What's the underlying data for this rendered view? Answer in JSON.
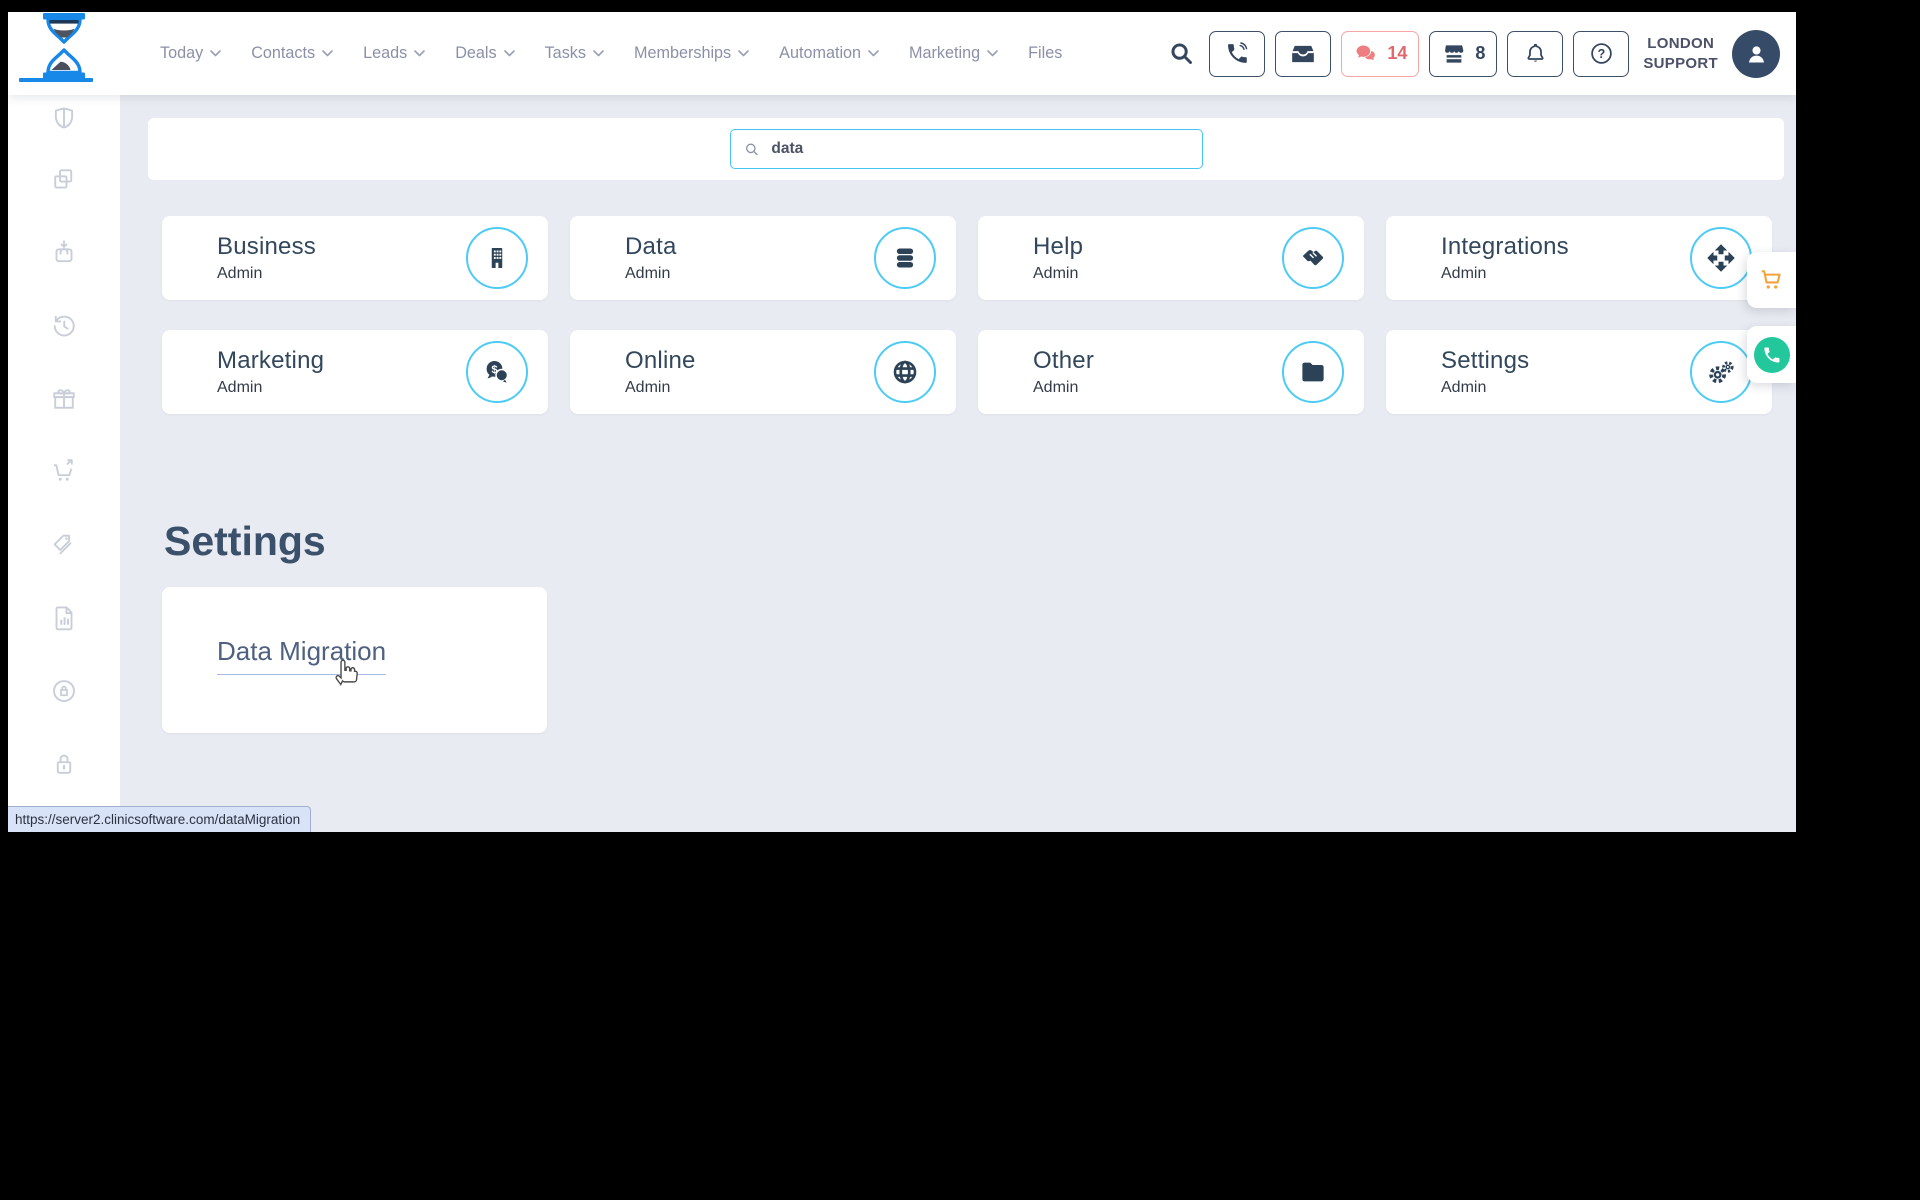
{
  "window": {
    "status_url": "https://server2.clinicsoftware.com/dataMigration"
  },
  "topbar": {
    "nav": [
      {
        "label": "Today"
      },
      {
        "label": "Contacts"
      },
      {
        "label": "Leads"
      },
      {
        "label": "Deals"
      },
      {
        "label": "Tasks"
      },
      {
        "label": "Memberships"
      },
      {
        "label": "Automation"
      },
      {
        "label": "Marketing"
      },
      {
        "label": "Files"
      }
    ],
    "chat_count": "14",
    "store_count": "8",
    "account_line1": "LONDON",
    "account_line2": "SUPPORT"
  },
  "search": {
    "value": "data"
  },
  "categories": [
    {
      "title": "Business",
      "subtitle": "Admin",
      "icon": "building-icon"
    },
    {
      "title": "Data",
      "subtitle": "Admin",
      "icon": "database-icon"
    },
    {
      "title": "Help",
      "subtitle": "Admin",
      "icon": "handshake-icon"
    },
    {
      "title": "Integrations",
      "subtitle": "Admin",
      "icon": "move-arrows-icon"
    },
    {
      "title": "Marketing",
      "subtitle": "Admin",
      "icon": "money-chat-icon"
    },
    {
      "title": "Online",
      "subtitle": "Admin",
      "icon": "globe-icon"
    },
    {
      "title": "Other",
      "subtitle": "Admin",
      "icon": "folder-icon"
    },
    {
      "title": "Settings",
      "subtitle": "Admin",
      "icon": "gears-icon"
    }
  ],
  "results_section": {
    "heading": "Settings",
    "links": [
      {
        "label": "Data Migration"
      }
    ]
  },
  "sidebar": {
    "icons": [
      "shield-icon",
      "copy-icon",
      "bag-download-icon",
      "history-icon",
      "gift-icon",
      "cart-arrow-icon",
      "tags-icon",
      "report-icon",
      "account-lock-icon",
      "padlock-icon"
    ]
  },
  "colors": {
    "accent_blue": "#45c5f3",
    "navy": "#33465e",
    "badge_red": "#ee7e82",
    "cart_orange": "#f2a33c",
    "whatsapp_green": "#22c79c",
    "logo_blue": "#1787e8",
    "background": "#e9ebf2"
  }
}
